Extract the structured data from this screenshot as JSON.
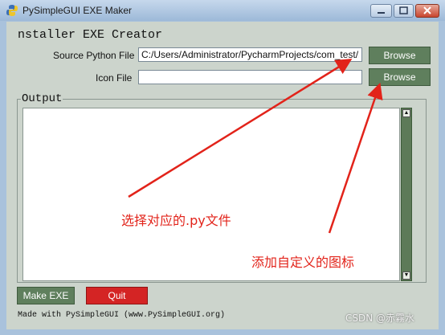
{
  "window": {
    "title": "PySimpleGUI EXE Maker"
  },
  "heading": "nstaller EXE Creator",
  "source": {
    "label": "Source Python File",
    "value": "C:/Users/Administrator/PycharmProjects/com_test/ma",
    "browse_label": "Browse"
  },
  "icon_file": {
    "label": "Icon File",
    "value": "",
    "browse_label": "Browse"
  },
  "output": {
    "title": "Output",
    "text": ""
  },
  "buttons": {
    "make_exe": "Make EXE",
    "quit": "Quit"
  },
  "footer": "Made with PySimpleGUI (www.PySimpleGUI.org)",
  "annotations": {
    "select_file": "选择对应的.py文件",
    "add_icon": "添加自定义的图标"
  },
  "watermark": "CSDN @赤霧水",
  "colors": {
    "button": "#5f7f5d",
    "quit": "#d42424",
    "annotation": "#e2231a",
    "client_bg": "#ccd4cc"
  }
}
